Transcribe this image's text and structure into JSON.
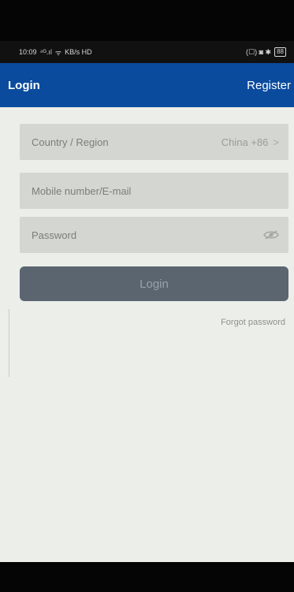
{
  "status_bar": {
    "time": "10:09",
    "signal_text": "⁴ᴳ.ıl",
    "wifi_text": "ᯤ",
    "network_text": "KB/s HD",
    "right_icons": "(☐) ◙ ✱",
    "battery": "88"
  },
  "app_bar": {
    "title": "Login",
    "register_label": "Register"
  },
  "form": {
    "country_label": "Country / Region",
    "country_value": "China +86",
    "chevron": ">",
    "mobile_placeholder": "Mobile number/E-mail",
    "password_placeholder": "Password",
    "login_label": "Login",
    "forgot_label": "Forgot password"
  },
  "colors": {
    "app_bar": "#0a4b9e",
    "background": "#eceee9",
    "field": "#d4d6d1",
    "login_button": "#5a6570"
  }
}
